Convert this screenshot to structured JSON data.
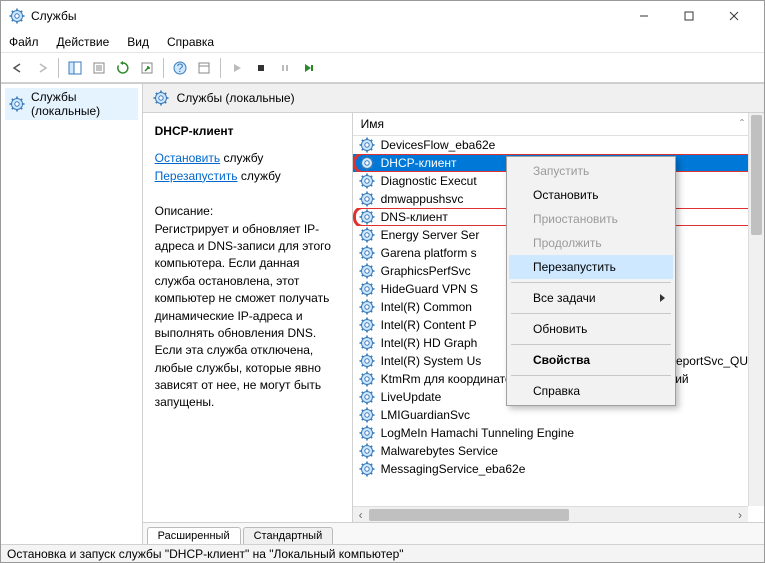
{
  "window": {
    "title": "Службы"
  },
  "menu": {
    "file": "Файл",
    "action": "Действие",
    "view": "Вид",
    "help": "Справка"
  },
  "left": {
    "services_local": "Службы (локальные)"
  },
  "header": {
    "title": "Службы (локальные)"
  },
  "detail": {
    "name": "DHCP-клиент",
    "stop_link": "Остановить",
    "stop_after": " службу",
    "restart_link": "Перезапустить",
    "restart_after": " службу",
    "desc_label": "Описание:",
    "desc": "Регистрирует и обновляет IP-адреса и DNS-записи для этого компьютера. Если данная служба остановлена, этот компьютер не сможет получать динамические IP-адреса и выполнять обновления DNS. Если эта служба отключена, любые службы, которые явно зависят от нее, не могут быть запущены."
  },
  "columns": {
    "name": "Имя"
  },
  "services": [
    {
      "name": "DevicesFlow_eba62e"
    },
    {
      "name": "DHCP-клиент",
      "selected": true,
      "hl": true
    },
    {
      "name": "Diagnostic Execut"
    },
    {
      "name": "dmwappushsvc"
    },
    {
      "name": "DNS-клиент",
      "hl": true
    },
    {
      "name": "Energy Server Ser"
    },
    {
      "name": "Garena platform s"
    },
    {
      "name": "GraphicsPerfSvc"
    },
    {
      "name": "HideGuard VPN S"
    },
    {
      "name": "Intel(R) Common"
    },
    {
      "name": "Intel(R) Content P"
    },
    {
      "name": "Intel(R) HD Graph"
    },
    {
      "name": "Intel(R) System Us",
      "tail": "ReportSvc_QU..."
    },
    {
      "name": "KtmRm для координатора распределенных транзакций"
    },
    {
      "name": "LiveUpdate"
    },
    {
      "name": "LMIGuardianSvc"
    },
    {
      "name": "LogMeIn Hamachi Tunneling Engine"
    },
    {
      "name": "Malwarebytes Service"
    },
    {
      "name": "MessagingService_eba62e"
    }
  ],
  "ctx": {
    "start": "Запустить",
    "stop": "Остановить",
    "pause": "Приостановить",
    "resume": "Продолжить",
    "restart": "Перезапустить",
    "all_tasks": "Все задачи",
    "refresh": "Обновить",
    "properties": "Свойства",
    "help": "Справка"
  },
  "tabs": {
    "extended": "Расширенный",
    "standard": "Стандартный"
  },
  "status": "Остановка и запуск службы \"DHCP-клиент\" на \"Локальный компьютер\""
}
